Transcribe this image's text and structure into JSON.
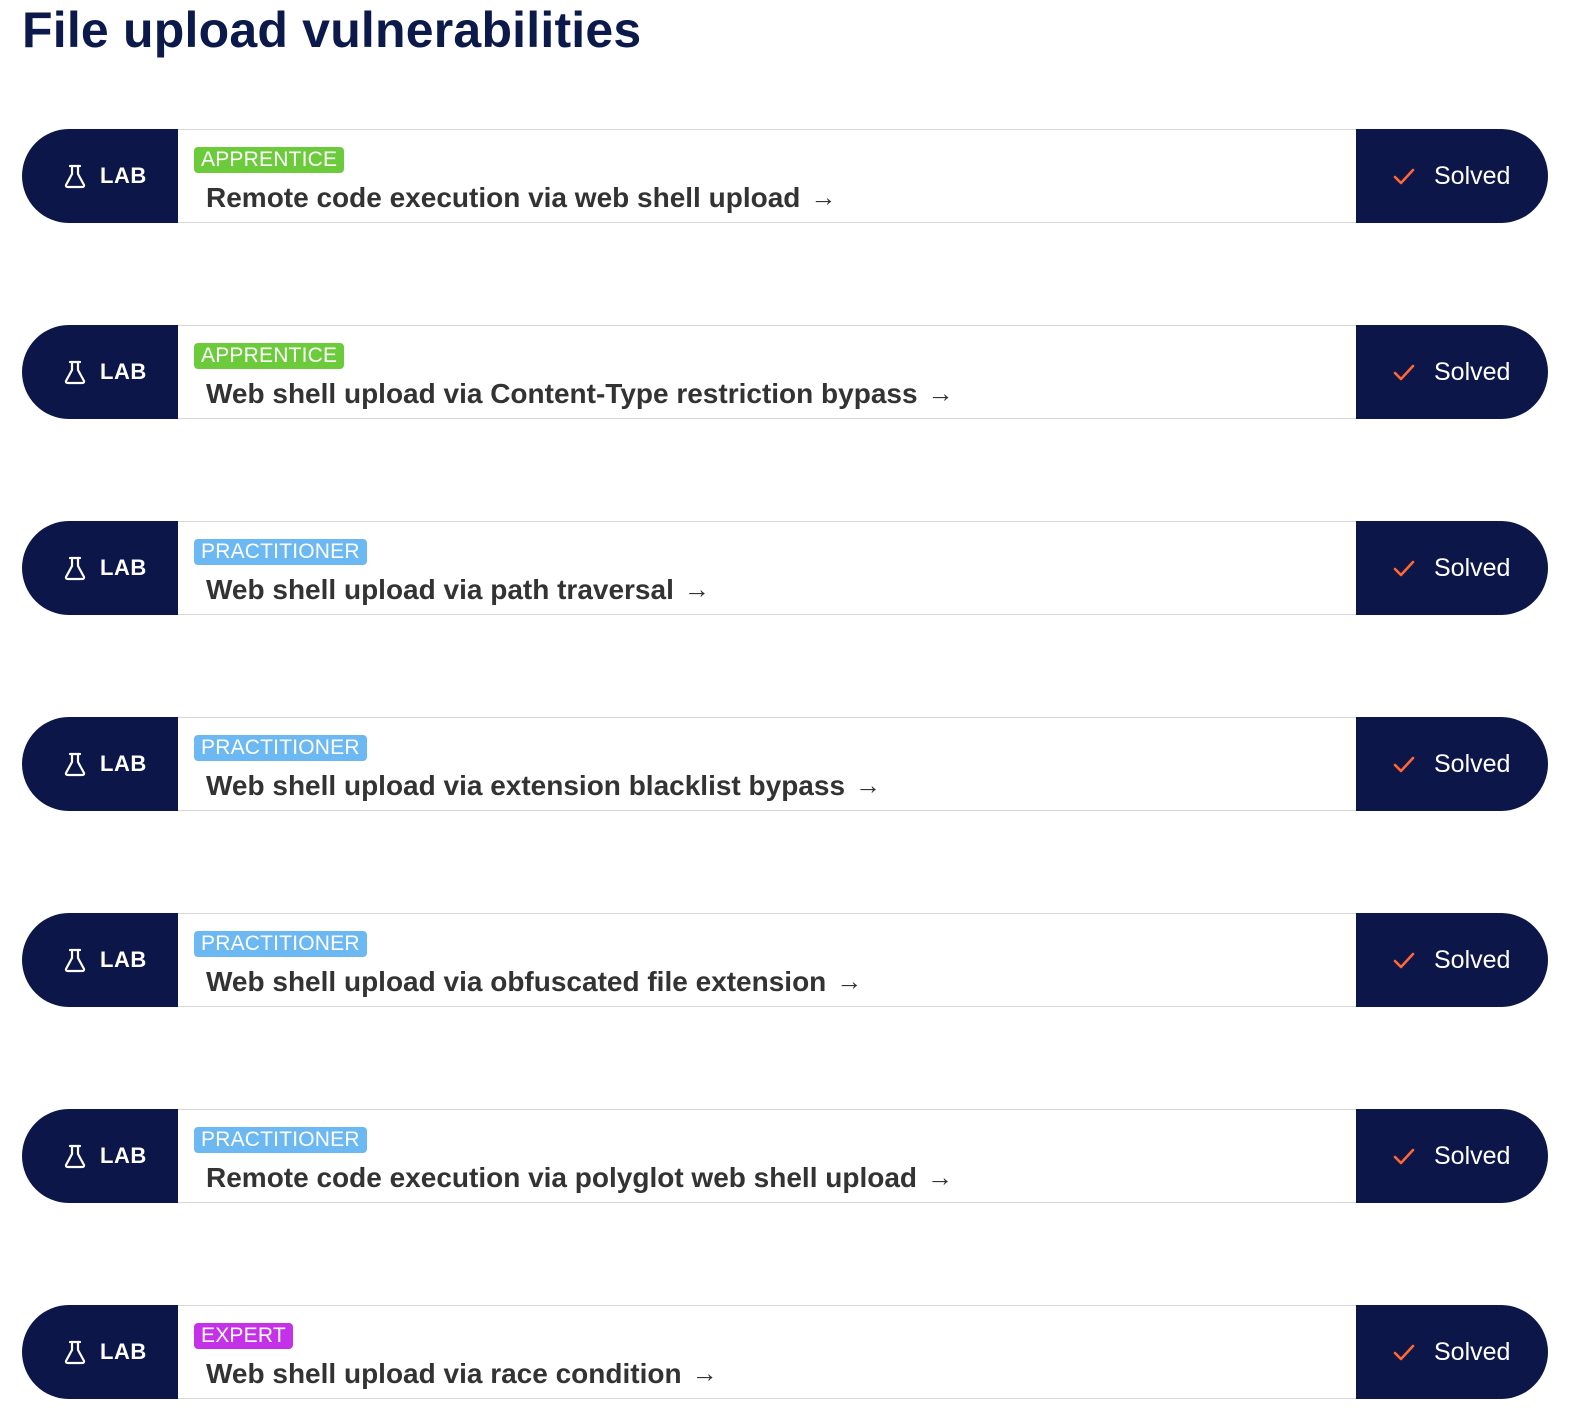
{
  "page": {
    "title": "File upload vulnerabilities"
  },
  "colors": {
    "navy": "#0c1649",
    "title": "#0b1a4b",
    "apprentice": "#6ccb3b",
    "practitioner": "#6cb8f2",
    "expert": "#c431e8",
    "check": "#ff6633"
  },
  "icons": {
    "lab": "flask-icon",
    "status": "check-icon",
    "link": "arrow-right-icon"
  },
  "labs": [
    {
      "badge": "LAB",
      "level": "APPRENTICE",
      "level_key": "apprentice",
      "title": "Remote code execution via web shell upload",
      "arrow": "→",
      "status": "Solved"
    },
    {
      "badge": "LAB",
      "level": "APPRENTICE",
      "level_key": "apprentice",
      "title": "Web shell upload via Content-Type restriction bypass",
      "arrow": "→",
      "status": "Solved"
    },
    {
      "badge": "LAB",
      "level": "PRACTITIONER",
      "level_key": "practitioner",
      "title": "Web shell upload via path traversal",
      "arrow": "→",
      "status": "Solved"
    },
    {
      "badge": "LAB",
      "level": "PRACTITIONER",
      "level_key": "practitioner",
      "title": "Web shell upload via extension blacklist bypass",
      "arrow": "→",
      "status": "Solved"
    },
    {
      "badge": "LAB",
      "level": "PRACTITIONER",
      "level_key": "practitioner",
      "title": "Web shell upload via obfuscated file extension",
      "arrow": "→",
      "status": "Solved"
    },
    {
      "badge": "LAB",
      "level": "PRACTITIONER",
      "level_key": "practitioner",
      "title": "Remote code execution via polyglot web shell upload",
      "arrow": "→",
      "status": "Solved"
    },
    {
      "badge": "LAB",
      "level": "EXPERT",
      "level_key": "expert",
      "title": "Web shell upload via race condition",
      "arrow": "→",
      "status": "Solved"
    }
  ]
}
